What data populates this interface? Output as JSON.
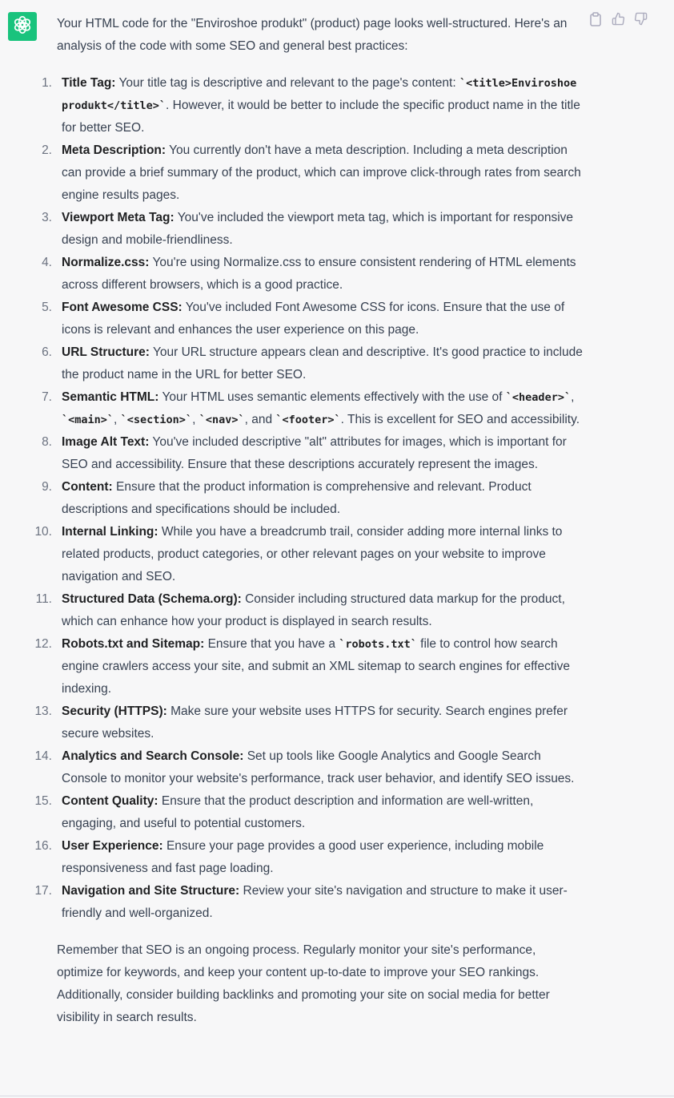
{
  "colors": {
    "avatar_bg": "#19c37d",
    "text": "#374151",
    "bg": "#f7f7f8"
  },
  "icons": {
    "avatar": "openai-logo-icon",
    "copy": "clipboard-icon",
    "like": "thumbs-up-icon",
    "dislike": "thumbs-down-icon"
  },
  "message": {
    "intro": "Your HTML code for the \"Enviroshoe produkt\" (product) page looks well-structured. Here's an analysis of the code with some SEO and general best practices:",
    "items": [
      {
        "num": "1.",
        "title": "Title Tag:",
        "parts": [
          {
            "t": " Your title tag is descriptive and relevant to the page's content: "
          },
          {
            "c": "`<title>Enviroshoe produkt</title>`"
          },
          {
            "t": ". However, it would be better to include the specific product name in the title for better SEO."
          }
        ]
      },
      {
        "num": "2.",
        "title": "Meta Description:",
        "parts": [
          {
            "t": " You currently don't have a meta description. Including a meta description can provide a brief summary of the product, which can improve click-through rates from search engine results pages."
          }
        ]
      },
      {
        "num": "3.",
        "title": "Viewport Meta Tag:",
        "parts": [
          {
            "t": " You've included the viewport meta tag, which is important for responsive design and mobile-friendliness."
          }
        ]
      },
      {
        "num": "4.",
        "title": "Normalize.css:",
        "parts": [
          {
            "t": " You're using Normalize.css to ensure consistent rendering of HTML elements across different browsers, which is a good practice."
          }
        ]
      },
      {
        "num": "5.",
        "title": "Font Awesome CSS:",
        "parts": [
          {
            "t": " You've included Font Awesome CSS for icons. Ensure that the use of icons is relevant and enhances the user experience on this page."
          }
        ]
      },
      {
        "num": "6.",
        "title": "URL Structure:",
        "parts": [
          {
            "t": " Your URL structure appears clean and descriptive. It's good practice to include the product name in the URL for better SEO."
          }
        ]
      },
      {
        "num": "7.",
        "title": "Semantic HTML:",
        "parts": [
          {
            "t": " Your HTML uses semantic elements effectively with the use of "
          },
          {
            "c": "`<header>`"
          },
          {
            "t": ", "
          },
          {
            "c": "`<main>`"
          },
          {
            "t": ", "
          },
          {
            "c": "`<section>`"
          },
          {
            "t": ", "
          },
          {
            "c": "`<nav>`"
          },
          {
            "t": ", and "
          },
          {
            "c": "`<footer>`"
          },
          {
            "t": ". This is excellent for SEO and accessibility."
          }
        ]
      },
      {
        "num": "8.",
        "title": "Image Alt Text:",
        "parts": [
          {
            "t": " You've included descriptive \"alt\" attributes for images, which is important for SEO and accessibility. Ensure that these descriptions accurately represent the images."
          }
        ]
      },
      {
        "num": "9.",
        "title": "Content:",
        "parts": [
          {
            "t": " Ensure that the product information is comprehensive and relevant. Product descriptions and specifications should be included."
          }
        ]
      },
      {
        "num": "10.",
        "title": "Internal Linking:",
        "parts": [
          {
            "t": " While you have a breadcrumb trail, consider adding more internal links to related products, product categories, or other relevant pages on your website to improve navigation and SEO."
          }
        ]
      },
      {
        "num": "11.",
        "title": "Structured Data (Schema.org):",
        "parts": [
          {
            "t": " Consider including structured data markup for the product, which can enhance how your product is displayed in search results."
          }
        ]
      },
      {
        "num": "12.",
        "title": "Robots.txt and Sitemap:",
        "parts": [
          {
            "t": " Ensure that you have a "
          },
          {
            "c": "`robots.txt`"
          },
          {
            "t": " file to control how search engine crawlers access your site, and submit an XML sitemap to search engines for effective indexing."
          }
        ]
      },
      {
        "num": "13.",
        "title": "Security (HTTPS):",
        "parts": [
          {
            "t": " Make sure your website uses HTTPS for security. Search engines prefer secure websites."
          }
        ]
      },
      {
        "num": "14.",
        "title": "Analytics and Search Console:",
        "parts": [
          {
            "t": " Set up tools like Google Analytics and Google Search Console to monitor your website's performance, track user behavior, and identify SEO issues."
          }
        ]
      },
      {
        "num": "15.",
        "title": "Content Quality:",
        "parts": [
          {
            "t": " Ensure that the product description and information are well-written, engaging, and useful to potential customers."
          }
        ]
      },
      {
        "num": "16.",
        "title": "User Experience:",
        "parts": [
          {
            "t": " Ensure your page provides a good user experience, including mobile responsiveness and fast page loading."
          }
        ]
      },
      {
        "num": "17.",
        "title": "Navigation and Site Structure:",
        "parts": [
          {
            "t": " Review your site's navigation and structure to make it user-friendly and well-organized."
          }
        ]
      }
    ],
    "outro": "Remember that SEO is an ongoing process. Regularly monitor your site's performance, optimize for keywords, and keep your content up-to-date to improve your SEO rankings. Additionally, consider building backlinks and promoting your site on social media for better visibility in search results."
  }
}
